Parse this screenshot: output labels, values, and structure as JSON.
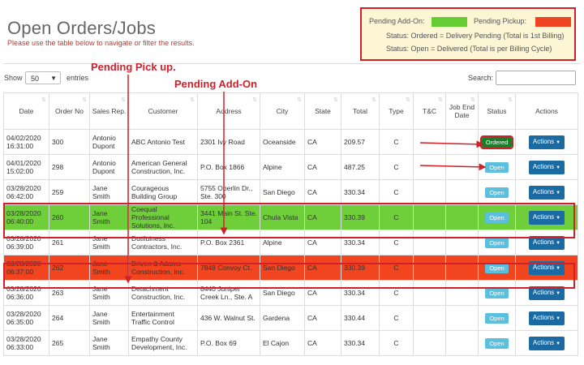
{
  "page": {
    "title": "Open Orders/Jobs",
    "subtitle": "Please use the table below to navigate or filter the results."
  },
  "legend": {
    "pending_addon_label": "Pending Add-On:",
    "pending_pickup_label": "Pending Pickup:",
    "ordered_note": "Status: Ordered = Delivery Pending (Total is 1st Billing)",
    "open_note": "Status: Open = Delivered (Total is per Billing Cycle)",
    "addon_color": "#66cc33",
    "pickup_color": "#ee4422"
  },
  "controls": {
    "show_label": "Show",
    "page_size": "50",
    "entries_label": "entries",
    "search_label": "Search:"
  },
  "annotations": {
    "pending_pickup": "Pending Pick up.",
    "pending_addon": "Pending Add-On"
  },
  "columns": [
    "Date",
    "Order No",
    "Sales Rep.",
    "Customer",
    "Address",
    "City",
    "State",
    "Total",
    "Type",
    "T&C",
    "Job End Date",
    "Status",
    "Actions"
  ],
  "rows": [
    {
      "date": "04/02/2020 16:31:00",
      "order": "300",
      "rep": "Antonio Dupont",
      "customer": "ABC Antonio Test",
      "address": "2301 Ivy Road",
      "city": "Oceanside",
      "state": "CA",
      "total": "209.57",
      "type": "C",
      "tc": "",
      "end": "",
      "status": "Ordered",
      "action": "Actions"
    },
    {
      "date": "04/01/2020 15:02:00",
      "order": "298",
      "rep": "Antonio Dupont",
      "customer": "American General Construction, Inc.",
      "address": "P.O. Box 1866",
      "city": "Alpine",
      "state": "CA",
      "total": "487.25",
      "type": "C",
      "tc": "",
      "end": "",
      "status": "Open",
      "action": "Actions"
    },
    {
      "date": "03/28/2020 06:42:00",
      "order": "259",
      "rep": "Jane Smith",
      "customer": "Courageous Building Group",
      "address": "5755 Oberlin Dr., Ste. 300",
      "city": "San Diego",
      "state": "CA",
      "total": "330.34",
      "type": "C",
      "tc": "",
      "end": "",
      "status": "Open",
      "action": "Actions"
    },
    {
      "date": "03/28/2020 06:40:00",
      "order": "260",
      "rep": "Jane Smith",
      "customer": "Coequal Professional Solutions, Inc.",
      "address": "3441 Main St. Ste. 104",
      "city": "Chula Vista",
      "state": "CA",
      "total": "330.39",
      "type": "C",
      "tc": "",
      "end": "",
      "status": "Open",
      "action": "Actions"
    },
    {
      "date": "03/28/2020 06:39:00",
      "order": "261",
      "rep": "Jane Smith",
      "customer": "Dutifulness Contractors, Inc.",
      "address": "P.O. Box 2361",
      "city": "Alpine",
      "state": "CA",
      "total": "330.34",
      "type": "C",
      "tc": "",
      "end": "",
      "status": "Open",
      "action": "Actions"
    },
    {
      "date": "03/28/2020 06:37:00",
      "order": "262",
      "rep": "Jane Smith",
      "customer": "Driven & Adams Construction, Inc.",
      "address": "7848 Convoy Ct.",
      "city": "San Diego",
      "state": "CA",
      "total": "330.39",
      "type": "C",
      "tc": "",
      "end": "",
      "status": "Open",
      "action": "Actions"
    },
    {
      "date": "03/28/2020 06:36:00",
      "order": "263",
      "rep": "Jane Smith",
      "customer": "Detachment Construction, Inc.",
      "address": "8440 Juniper Creek Ln., Ste. A",
      "city": "San Diego",
      "state": "CA",
      "total": "330.34",
      "type": "C",
      "tc": "",
      "end": "",
      "status": "Open",
      "action": "Actions"
    },
    {
      "date": "03/28/2020 06:35:00",
      "order": "264",
      "rep": "Jane Smith",
      "customer": "Entertainment Traffic Control",
      "address": "436 W. Walnut St.",
      "city": "Gardena",
      "state": "CA",
      "total": "330.44",
      "type": "C",
      "tc": "",
      "end": "",
      "status": "Open",
      "action": "Actions"
    },
    {
      "date": "03/28/2020 06:33:00",
      "order": "265",
      "rep": "Jane Smith",
      "customer": "Empathy County Development, Inc.",
      "address": "P.O. Box 69",
      "city": "El Cajon",
      "state": "CA",
      "total": "330.34",
      "type": "C",
      "tc": "",
      "end": "",
      "status": "Open",
      "action": "Actions"
    }
  ]
}
